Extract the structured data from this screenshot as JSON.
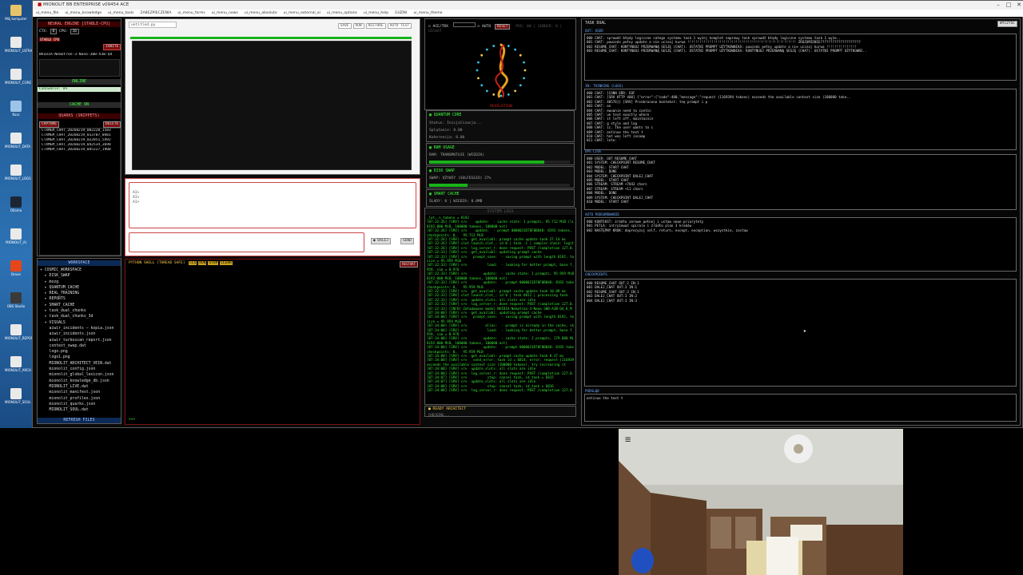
{
  "desktop": {
    "icons": [
      "Mój komputer",
      "MIONOLIT_ULTRA",
      "MIONOLIT_CORE",
      "Kosz",
      "MIONOLIT_DATA",
      "MIONOLIT_LOGS",
      "Ollama",
      "MIONOLIT_AI",
      "Brave",
      "OBS Studio",
      "MIONOLIT_REPORT",
      "MIONOLIT_ARCH",
      "MIONOLIT_SOUL"
    ]
  },
  "window": {
    "title": "MIONOLIT BB ENTERPRISE v09454 ACE",
    "menu": [
      "ui_menu_file",
      "ui_menu_knowledge",
      "ui_menu_tools",
      "ZABEZPIECZENIA",
      "ui_menu_forms",
      "ui_menu_news",
      "ui_menu_absolute",
      "ui_menu_external_ai",
      "ui_menu_options",
      "ui_menu_help",
      "GUZIKI",
      "ui_menu_theme"
    ],
    "controls": [
      "–",
      "□",
      "✕"
    ]
  },
  "left": {
    "engine_title": "NEURAL ENGINE [STABLE-CPU]",
    "ctx_label": "CTX:",
    "ctx_value": "8",
    "cpu_label": "CPU:",
    "cpu_value": "16",
    "stable_tag": "STABLE CPU",
    "ignite": "IGNITE",
    "model": "NVIDIA-Nemotron-3-Nano-30B-A3B-Q4",
    "online": "ONLINE",
    "loading": "Ładowanie: 0%",
    "cache": "CACHE ON",
    "quarks_title": "QUARKS (SNIPPETS)",
    "capture": "CAPTURE",
    "delete": "DELETE",
    "quarks": [
      "CTXMEM_CHAT_20260219_002220_1583",
      "CTXMEM_CHAT_20260219_013707_0481",
      "CTXMEM_CHAT_20260219_022851_5492",
      "CTXMEM_CHAT_20260219_042534_3698",
      "CTXMEM_CHAT_20260219_045227_1900"
    ],
    "workspace_title": "WORKSPACE",
    "tree": [
      "▾ COSMIC_WORKSPACE",
      "  ▸ DISK_SWAP",
      "  ▸ mozg",
      "  ▸ QUANTUM_CACHE",
      "  ▸ REAL_TRAINING",
      "  ▸ REPORTS",
      "  ▸ SMART_CACHE",
      "  ▸ task_dual_chunks",
      "  ▸ task_dual_chunks_3d",
      "  ▾ VISUALS",
      "    aiwir_incidents — kopia.json",
      "    aiwir_incidents.json",
      "    aiwir_turboscan_report.json",
      "    context_swap.dat",
      "    logo.png",
      "    logo1.png",
      "    MIONOLIT_ARCHITECT_VEIN.dat",
      "    mionolit_config.json",
      "    mionolit_global_lexicon.json",
      "    mionolit_knowledge_db.json",
      "    MIONOLIT_LIVE.dat",
      "    mionolit_manifest.json",
      "    mionolit_profiles.json",
      "    mionolit_quarks.json",
      "    MIONOLIT_SOUL.dat"
    ],
    "refresh": "REFRESH FILES"
  },
  "editor": {
    "tab": "untitled.py",
    "buttons": [
      "SAVE",
      "RUN",
      "RESTORE",
      "AUTO TEST"
    ],
    "prompt_lines": [
      "AI>",
      "AI>",
      "AI>"
    ],
    "dalej": "DALEJ",
    "send": "SEND",
    "shell_title": "PYTHON SHELL [THREAD SAFE]",
    "shell_tags": [
      "CLS",
      "RUN",
      "STOP",
      "CLEAR"
    ],
    "shell_restart": "RESTART",
    "shell_prompt": ">>>"
  },
  "middle": {
    "architect": "ACE/TRX",
    "auto": "AUTO",
    "reset": "RESET",
    "mini_tags": "PSS: 00 | SENDER: 0 | UICHAT",
    "revelation": "REVELATION",
    "quantum_title": "QUANTUM CORE",
    "quantum_lines": [
      "Status: Inicjalizacja...",
      "Splątanie: 0.00",
      "Koherencja: 0.00"
    ],
    "ram_title": "RAM USAGE",
    "ram_text": "RAM: TRANSMUTUJE (WIEDZA)",
    "ram_fill": 0.82,
    "disk_title": "DISK SWAP",
    "disk_text": "SWAP: OŻYWIY (SOLFEGGIO) 27%",
    "disk_fill": 0.27,
    "smart_title": "SMART CACHE",
    "smart_text": "ŚLADY: 0 | WIEDZA: 0.0MB",
    "syslog_title": "SYSTEM LOGS",
    "syslog": [
      "_lot, n_tokens = 8192",
      "[07:32:26] [SRV] srv    update:  - cache state: 1 prompts, 95.712 MiB (limits:",
      "8192.000 MiB, 100000 tokens, 100000 est)",
      "[07:32:26] [SRV] srv    update:  - prompt 0000021D78F0B848: 8192 tokens,",
      "checkpoints: 0,   95.712 MiB",
      "[07:32:26] [SRV] srv  get_availabl: prompt cache update took 27.14 ms",
      "[07:32:26] [SRV] slot launch_slot_: id 0 | task -1 | sampler chain: logits",
      "[07:32:26] [SRV] srv  log_server_r: done request: POST /completion 127.0.0.1 200",
      "[07:32:33] [SRV] srv  get_availabl: updating prompt cache",
      "[07:32:33] [SRV] srv   prompt_save:  - saving prompt with length 8192, total state",
      "size = 95.959 MiB",
      "[07:32:33] [SRV] srv          load:  - looking for better prompt, base f_keep = 0.",
      "959, sim = 0.976",
      "[07:32:33] [SRV] srv        update:  - cache state: 1 prompts, 95.959 MiB (limits:",
      "8192.000 MiB, 100000 tokens, 100000 est)",
      "[07:32:33] [SRV] srv        update:  - prompt 0000021D78F0B848: 8192 tokens,",
      "checkpoints: 0,   95.959 MiB",
      "[07:32:33] [SRV] srv  get_availabl: prompt cache update took 10.89 ms",
      "[07:32:33] [SRV] slot launch_slot_: id 0 | task 6812 | processing task",
      "[07:32:33] [SRV] srv  update_slots: all slots are idle",
      "[07:32:33] [SRV] srv  log_server_r: done request: POST /completion 127.0.0.1 200",
      "[07:32:33] [INFO] Załadowano model NVIDIA-Nemotron-3-Nano-30B-A3B-Q4_K_M",
      "[07:34:00] [SRV] srv  get_availabl: updating prompt cache",
      "[07:34:00] [SRV] srv   prompt_save:  - saving prompt with length 8192, total state",
      "size = 95.959 MiB",
      "[07:34:00] [SRV] srv         alloc:  - prompt is already in the cache, skipping",
      "[07:34:00] [SRV] srv          load:  - looking for better prompt, base f_keep = 0.",
      "959, sim = 0.976",
      "[07:34:00] [SRV] srv        update:  - cache state: 2 prompts, 179.880 MiB (limits:",
      "8192.000 MiB, 100000 tokens, 100000 est)",
      "[07:34:00] [SRV] srv        update:  - prompt 0000021D78F0B848: 8192 tokens,",
      "checkpoints: 0,   95.959 MiB",
      "[07:34:00] [SRV] srv  get_availabl: prompt cache update took 8.37 ms",
      "[07:34:00] [SRV] srv   send_error: task id = 6814, error: request (1169394 tokens)",
      "exceeds the available context size (100000 tokens), try increasing it",
      "[07:34:00] [SRV] srv  update_slots: all slots are idle",
      "[07:34:00] [SRV] srv  log_server_r: done request: POST /completion 127.0.0.1 200",
      "[07:34:07] [SRV] srv          stop: cancel task, id_task = 6815",
      "[07:34:07] [SRV] srv  update_slots: all slots are idle",
      "[07:34:08] [SRV] srv          stop: cancel task, id_task = 6816",
      "[07:34:08] [SRV] srv  log_server_r: done request: POST /completion 127.0.0.1 200"
    ],
    "ready": "READY ARCHITECT",
    "checking": "CHECKING..."
  },
  "right": {
    "title": "TASK DUAL",
    "wyczysc": "WYCZYŚĆ",
    "out_title": "OUT: USER",
    "out_lines": [
      "000 CHAT: sprawdź błędy logiczne całego systemu task 1 wyżej komplet naprawy task sprawdź błędy logiczne systemu task 1 wyże..",
      "001 CHAT: powiedz pełny update a nie ucinaj kurwa !!!!!!!!!!!!!!!!!!!!!!!!!!!!!!!!!!!!!!!!!!!!!!!!!!!!!! ZROZUMIENIE????????????????????",
      "002 RESUME_CHAT: KONTYNUUJ PRZERWANĄ SESJĘ (CHAT). OSTATNI PROMPT UŻYTKOWNIKA: powiedz pełny update a nie ucinaj kurwa !!!!!!!!!!!!!!!",
      "003 RESUME_CHAT: KONTYNUUJ PRZERWANĄ SESJĘ (CHAT). OSTATNI PROMPT UŻYTKOWNIKA: KONTYNUUJ PRZERWANĄ SESJĘ (CHAT). OSTATNI PROMPT UŻYTKOWNI.."
    ],
    "think_title": "IN: THINKING (LOGS)",
    "think_lines": [
      "000 CHAT: [CONN ERR: EOF",
      "001 CHAT: [SRV HTTP 400] {\"error\":{\"code\":400,\"message\":\"request (1169394 tokens) exceeds the available context size (100000 toke..",
      "002 CHAT: 40576}} [SRV] Przebrocono kontekst: tnę prompt i p",
      "003 CHAT: on",
      "004 CHAT: ewuanie need to contin",
      "005 CHAT: ue text exactly where",
      "006 CHAT: it left off, maintainin",
      "007 CHAT: g style and log",
      "008 CHAT: ic. The user wants to c",
      "009 CHAT: ontinue the text t",
      "010 CHAT: hat was left incomp",
      "011 CHAT: lete: '"
    ],
    "ops_title": "OPS LIVE",
    "ops_lines": [
      "000 USER: OUT RESUME_CHAT",
      "001 SYSTEM: CHECKPOINT RESUME_CHAT",
      "002 MODEL: START CHAT",
      "003 MODEL: DONE",
      "004 SYSTEM: CHECKPOINT DALEJ_CHAT",
      "005 MODEL: START CHAT",
      "006 STREAM: STREAM +7843 chars",
      "007 STREAM: STREAM +11 chars",
      "008 MODEL: DONE",
      "009 SYSTEM: CHECKPOINT DALEJ_CHAT",
      "010 MODEL: START CHAT"
    ],
    "auto_title": "AUTO PODSUMOWANIE",
    "auto_lines": [
      "000 KONTEKST: źródło zerowe pełnej i ustaw nowe priorytety",
      "001 PETLA: intryżować spirale i źródło plan 3 kroków",
      "002 NASTĘPNY KROK: doprecyzuj self, return, except, exception, wszystkie, zostaw"
    ],
    "check_title": "CHECKPOINTS",
    "check_lines": [
      "000 RESUME_CHAT OUT:2 IN:1",
      "001 DALEJ_CHAT OUT:3 IN:1",
      "002 RESUME_CHAT OUT:3 IN:1",
      "003 DALEJ_CHAT OUT:3 IN:2",
      "004 DALEJ_CHAT OUT:3 IN:3"
    ],
    "input_title": "PODGLĄD",
    "input_text": "ontinue the text t"
  },
  "colors": {
    "accent_red": "#7a1010",
    "terminal_green": "#39e639",
    "progress_green": "#19b319"
  }
}
